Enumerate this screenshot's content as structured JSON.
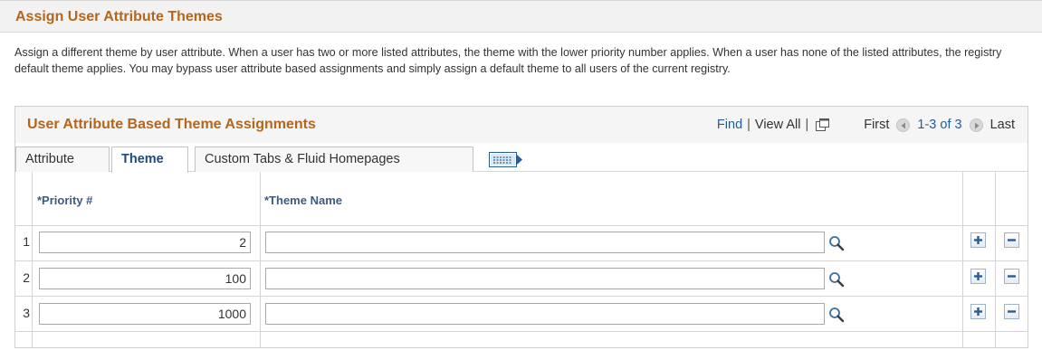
{
  "page": {
    "title": "Assign User Attribute Themes",
    "description": "Assign a different theme by user attribute. When a user has two or more listed attributes, the theme with the lower priority number applies. When a user has none of the listed attributes, the registry default theme applies. You may bypass user attribute based assignments and simply assign a default theme to all users of the current registry."
  },
  "grid": {
    "title": "User Attribute Based Theme Assignments",
    "nav": {
      "find": "Find",
      "separator": "|",
      "view_all": "View All",
      "first": "First",
      "range": "1-3 of 3",
      "last": "Last"
    },
    "tabs": [
      "Attribute",
      "Theme",
      "Custom Tabs & Fluid Homepages"
    ],
    "active_tab": "Theme",
    "columns": {
      "priority": "*Priority #",
      "theme_name": "*Theme Name"
    },
    "rows": [
      {
        "num": "1",
        "priority": "2",
        "theme_name": ""
      },
      {
        "num": "2",
        "priority": "100",
        "theme_name": ""
      },
      {
        "num": "3",
        "priority": "1000",
        "theme_name": ""
      }
    ]
  },
  "colors": {
    "title": "#b5661c",
    "link": "#1f5e9a",
    "column_header": "#3d5b80"
  },
  "icons": {
    "lookup": "magnifier-icon",
    "add_row": "plus-icon",
    "delete_row": "minus-icon",
    "zoom": "popup-window-icon",
    "prev": "left-arrow-icon",
    "next": "right-arrow-icon",
    "show_all_columns": "show-all-columns-icon"
  }
}
